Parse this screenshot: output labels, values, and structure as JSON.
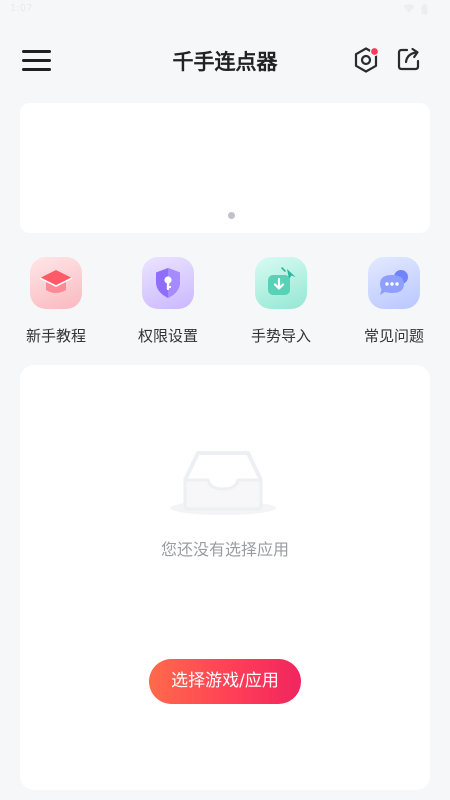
{
  "status_bar": {
    "time": "1:07"
  },
  "header": {
    "title": "千手连点器",
    "menu_icon": "hamburger-menu-icon",
    "settings_icon": "hexagon-settings-icon",
    "share_icon": "share-export-icon"
  },
  "banner": {
    "page_count": 1,
    "active_page": 1
  },
  "quick_actions": [
    {
      "label": "新手教程",
      "icon": "graduation-cap-icon"
    },
    {
      "label": "权限设置",
      "icon": "shield-key-icon"
    },
    {
      "label": "手势导入",
      "icon": "gesture-import-icon"
    },
    {
      "label": "常见问题",
      "icon": "chat-bubble-icon"
    }
  ],
  "app_panel": {
    "empty_text": "您还没有选择应用",
    "select_button_label": "选择游戏/应用"
  },
  "colors": {
    "accent_start": "#ff6a4b",
    "accent_end": "#f0255e",
    "settings_badge": "#ff3b5c"
  }
}
